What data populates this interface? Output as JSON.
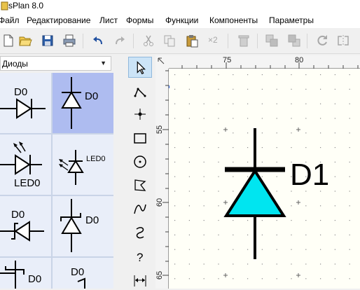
{
  "window": {
    "title": "sPlan 8.0"
  },
  "menu": [
    "Файл",
    "Редактирование",
    "Лист",
    "Формы",
    "Функции",
    "Компоненты",
    "Параметры"
  ],
  "toolbar": {
    "icons": [
      "new-icon",
      "open-icon",
      "save-icon",
      "print-icon",
      "undo-icon",
      "redo-icon",
      "cut-icon",
      "copy-icon",
      "paste-icon",
      "duplicate-icon",
      "delete-icon",
      "to-front-icon",
      "to-back-icon",
      "refresh-icon",
      "mirror-icon"
    ],
    "duplicate_label": "×2"
  },
  "library": {
    "selected": "Диоды",
    "items": [
      {
        "label": "D0",
        "symbol": "diode-horizontal"
      },
      {
        "label": "D0",
        "symbol": "diode-vertical",
        "selected": true
      },
      {
        "label": "LED0",
        "symbol": "led-horizontal"
      },
      {
        "label": "LED0",
        "symbol": "led-vertical"
      },
      {
        "label": "D0",
        "symbol": "zener-horizontal"
      },
      {
        "label": "D0",
        "symbol": "zener-vertical"
      },
      {
        "label": "D0",
        "symbol": "schottky-horizontal"
      },
      {
        "label": "D0",
        "symbol": "schottky-vertical"
      }
    ]
  },
  "tools": [
    "pointer-icon",
    "line-icon",
    "node-icon",
    "rectangle-icon",
    "circle-icon",
    "polygon-icon",
    "bezier-icon",
    "curve-icon",
    "help-icon",
    "dimension-icon"
  ],
  "ruler": {
    "horizontal": [
      "75",
      "80"
    ],
    "vertical": [
      "55",
      "60",
      "65"
    ]
  },
  "canvas": {
    "component_label": "D1",
    "diode_fill": "#00e5f0"
  }
}
